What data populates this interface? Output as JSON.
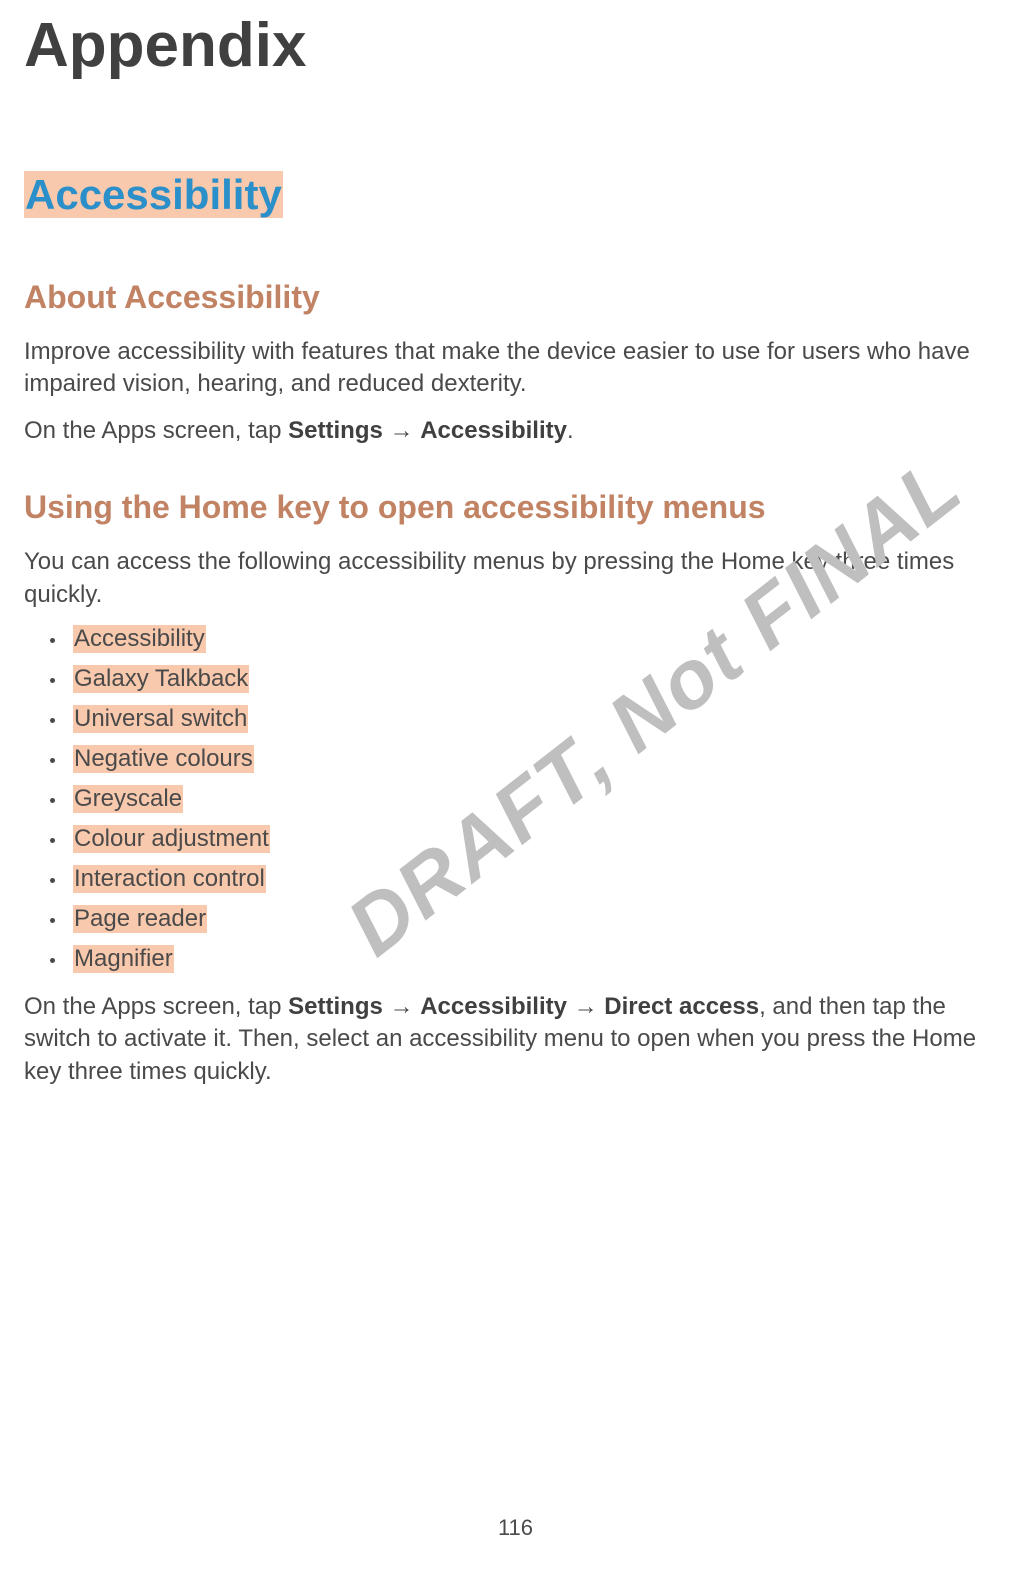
{
  "page_title": "Appendix",
  "section_title": "Accessibility",
  "watermark": "DRAFT, Not FINAL",
  "page_number": "116",
  "about": {
    "heading": "About Accessibility",
    "p1": "Improve accessibility with features that make the device easier to use for users who have impaired vision, hearing, and reduced dexterity.",
    "p2_pre": "On the Apps screen, tap ",
    "p2_settings": "Settings",
    "p2_arrow": " → ",
    "p2_access": "Accessibility",
    "p2_post": "."
  },
  "homekey": {
    "heading": "Using the Home key to open accessibility menus",
    "p1": "You can access the following accessibility menus by pressing the Home key three times quickly.",
    "items": [
      "Accessibility",
      "Galaxy Talkback",
      "Universal switch",
      "Negative colours",
      "Greyscale",
      "Colour adjustment",
      "Interaction control",
      "Page reader",
      "Magnifier"
    ],
    "p2_pre": "On the Apps screen, tap ",
    "p2_settings": "Settings",
    "p2_arrow1": " → ",
    "p2_access": "Accessibility",
    "p2_arrow2": " → ",
    "p2_direct": "Direct access",
    "p2_post": ", and then tap the switch to activate it. Then, select an accessibility menu to open when you press the Home key three times quickly."
  }
}
